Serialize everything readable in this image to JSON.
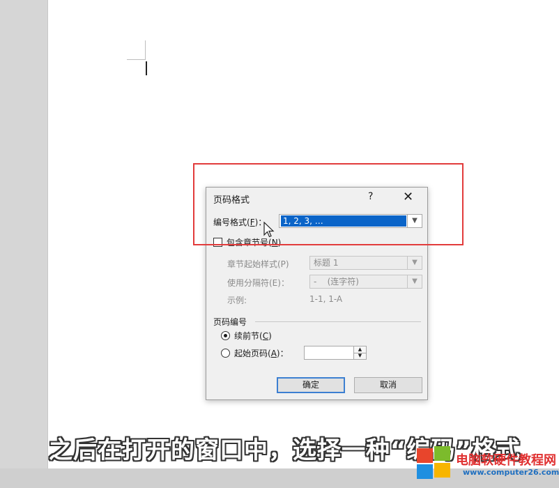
{
  "dialog": {
    "title": "页码格式",
    "help": "?",
    "close": "✕",
    "number_format": {
      "label_prefix": "编号格式(",
      "label_key": "F",
      "label_suffix": ")：",
      "value": "1, 2, 3, …"
    },
    "include_chapter": {
      "label_prefix": "包含章节号(",
      "label_key": "N",
      "label_suffix": ")",
      "checked": false
    },
    "chapter_style": {
      "label": "章节起始样式(P)",
      "value": "标题 1"
    },
    "separator": {
      "label": "使用分隔符(E)：",
      "value": "-    (连字符)"
    },
    "example": {
      "label": "示例:",
      "value": "1-1, 1-A"
    },
    "page_numbering": {
      "group_label": "页码编号",
      "continue": {
        "label_prefix": "续前节(",
        "label_key": "C",
        "label_suffix": ")",
        "checked": true
      },
      "start_at": {
        "label_prefix": "起始页码(",
        "label_key": "A",
        "label_suffix": ")：",
        "checked": false,
        "value": ""
      }
    },
    "ok_button": "确定",
    "cancel_button": "取消"
  },
  "caption": "之后在打开的窗口中，选择一种“编码”格式",
  "watermark": {
    "title": "电脑软硬件教程网",
    "url": "www.computer26.com"
  },
  "colors": {
    "highlight_border": "#e23b3b",
    "selection": "#0a64c8"
  }
}
